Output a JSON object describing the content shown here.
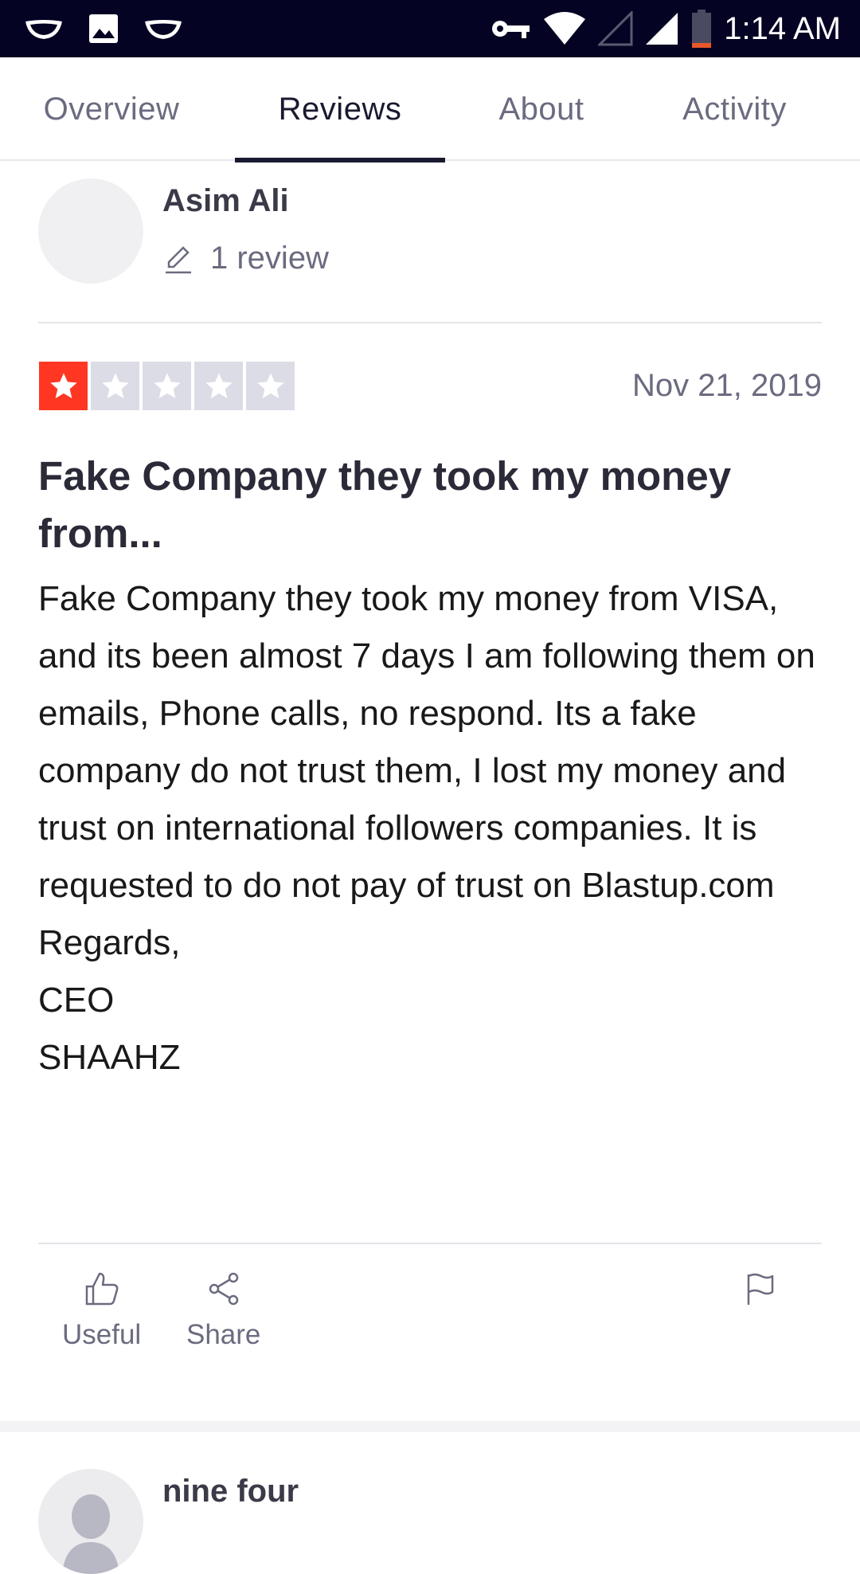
{
  "status_bar": {
    "time": "1:14 AM",
    "left_icons": [
      "notification-icon",
      "image-icon",
      "notification-icon"
    ],
    "right_icons": [
      "key-icon",
      "wifi-icon",
      "signal-empty-icon",
      "signal-icon",
      "battery-low-icon"
    ]
  },
  "tabs": [
    {
      "label": "Overview",
      "active": false
    },
    {
      "label": "Reviews",
      "active": true
    },
    {
      "label": "About",
      "active": false
    },
    {
      "label": "Activity",
      "active": false
    }
  ],
  "review": {
    "reviewer_name": "Asim Ali",
    "review_count": "1 review",
    "rating": 1,
    "max_rating": 5,
    "date": "Nov 21, 2019",
    "title": "Fake Company they took my money from...",
    "body": "Fake Company they took my money from VISA, and its been almost 7 days I am following them on emails, Phone calls, no respond. Its a fake company do not trust them, I lost my money and trust on international followers companies. It is requested to do not pay of trust on Blastup.com\nRegards,\nCEO\nSHAAHZ",
    "actions": {
      "useful_label": "Useful",
      "share_label": "Share"
    }
  },
  "next_review": {
    "reviewer_name": "nine four"
  },
  "colors": {
    "status_bar": "#050323",
    "star_filled": "#ff3722",
    "star_empty": "#dcdce6",
    "text_muted": "#6b6b80"
  }
}
